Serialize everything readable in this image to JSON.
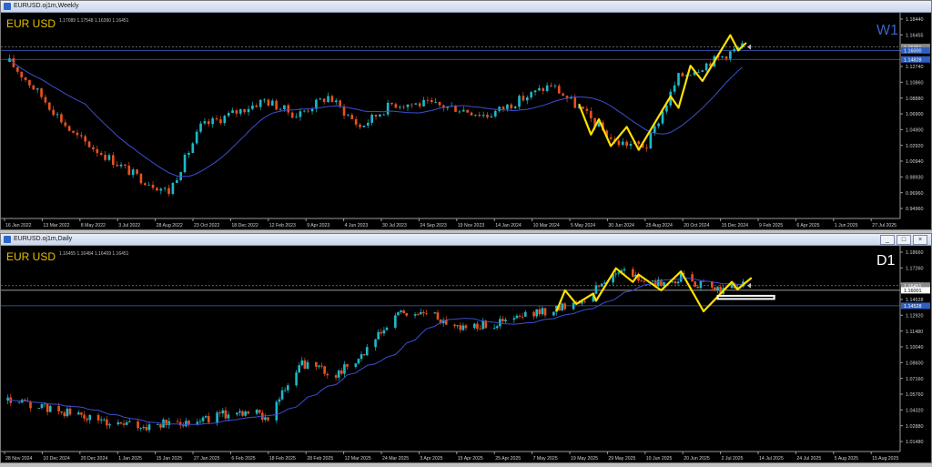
{
  "windows": [
    {
      "id": "weekly",
      "title": "EURUSD.oj1m,Weekly",
      "ohlc": "1.17089 1.17548 1.16390 1.16451",
      "symbol_label": "EUR USD",
      "timeframe_label": "W1",
      "price_ticks": [
        "1.18440",
        "1.16455",
        "1.14828",
        "1.12740",
        "1.10860",
        "1.08880",
        "1.06900",
        "1.04900",
        "1.02920",
        "1.00940",
        "0.98930",
        "0.96960",
        "0.94960"
      ],
      "price_badges": [
        {
          "value": "1.16451",
          "color": "#8a8a8a"
        },
        {
          "value": "1.16000",
          "color": "#2f5fbf"
        },
        {
          "value": "1.14828",
          "color": "#2f5fbf"
        }
      ],
      "date_ticks": [
        "16 Jan 2022",
        "13 Mar 2022",
        "8 May 2022",
        "3 Jul 2022",
        "28 Aug 2022",
        "23 Oct 2022",
        "18 Dec 2022",
        "12 Feb 2023",
        "9 Apr 2023",
        "4 Jun 2023",
        "30 Jul 2023",
        "24 Sep 2023",
        "19 Nov 2023",
        "14 Jan 2024",
        "10 Mar 2024",
        "5 May 2024",
        "30 Jun 2024",
        "25 Aug 2024",
        "20 Oct 2024",
        "15 Dec 2024",
        "9 Feb 2025",
        "6 Apr 2025",
        "1 Jun 2025",
        "27 Jul 2025"
      ]
    },
    {
      "id": "daily",
      "title": "EURUSD.oj1m,Daily",
      "ohlc": "1.16455 1.16484 1.16409 1.16451",
      "symbol_label": "EUR USD",
      "timeframe_label": "D1",
      "price_ticks": [
        "1.18660",
        "1.17260",
        "1.16001",
        "1.14528",
        "1.12920",
        "1.11480",
        "1.10040",
        "1.08600",
        "1.07160",
        "1.05760",
        "1.04320",
        "1.02880",
        "1.01480"
      ],
      "price_badges": [
        {
          "value": "1.16451",
          "color": "#8a8a8a"
        },
        {
          "value": "1.16001",
          "color": "#ffffff"
        },
        {
          "value": "1.14528",
          "color": "#2f5fbf"
        }
      ],
      "date_ticks": [
        "28 Nov 2024",
        "10 Dec 2024",
        "20 Dec 2024",
        "1 Jan 2025",
        "15 Jan 2025",
        "27 Jan 2025",
        "6 Feb 2025",
        "18 Feb 2025",
        "28 Feb 2025",
        "12 Mar 2025",
        "24 Mar 2025",
        "3 Apr 2025",
        "15 Apr 2025",
        "25 Apr 2025",
        "7 May 2025",
        "19 May 2025",
        "29 May 2025",
        "10 Jun 2025",
        "20 Jun 2025",
        "2 Jul 2025",
        "14 Jul 2025",
        "24 Jul 2025",
        "5 Aug 2025",
        "15 Aug 2025"
      ]
    }
  ],
  "window_buttons": {
    "minimize": "_",
    "maximize": "□",
    "close": "×"
  },
  "chart_data": [
    {
      "type": "candlestick",
      "title": "EURUSD.oj1m,Weekly",
      "series_name": "EUR USD",
      "timeframe": "W1",
      "ylim": [
        0.945,
        1.195
      ],
      "grid": false,
      "colors": {
        "bull": "#1fb8c8",
        "bear": "#e8501e",
        "ma": "#3c4fd0",
        "zigzag": "#ffe000"
      },
      "key_points": [
        {
          "date": "16 Jan 2022",
          "close": 1.145
        },
        {
          "date": "13 Mar 2022",
          "close": 1.1
        },
        {
          "date": "8 May 2022",
          "close": 1.05
        },
        {
          "date": "28 Aug 2022",
          "close": 0.995
        },
        {
          "date": "23 Oct 2022",
          "close": 0.975
        },
        {
          "date": "18 Dec 2022",
          "close": 1.06
        },
        {
          "date": "9 Apr 2023",
          "close": 1.095
        },
        {
          "date": "4 Jun 2023",
          "close": 1.075
        },
        {
          "date": "30 Jul 2023",
          "close": 1.1
        },
        {
          "date": "24 Sep 2023",
          "close": 1.06
        },
        {
          "date": "19 Nov 2023",
          "close": 1.09
        },
        {
          "date": "14 Jan 2024",
          "close": 1.09
        },
        {
          "date": "10 Mar 2024",
          "close": 1.085
        },
        {
          "date": "5 May 2024",
          "close": 1.075
        },
        {
          "date": "25 Aug 2024",
          "close": 1.115
        },
        {
          "date": "20 Oct 2024",
          "close": 1.08
        },
        {
          "date": "15 Dec 2024",
          "close": 1.04
        },
        {
          "date": "9 Feb 2025",
          "close": 1.035
        },
        {
          "date": "6 Apr 2025",
          "close": 1.125
        },
        {
          "date": "1 Jun 2025",
          "close": 1.145
        },
        {
          "date": "27 Jul 2025",
          "close": 1.165
        }
      ],
      "zigzag": [
        {
          "date": "13 Oct 2024",
          "price": 1.09
        },
        {
          "date": "3 Nov 2024",
          "price": 1.05
        },
        {
          "date": "17 Nov 2024",
          "price": 1.07
        },
        {
          "date": "8 Dec 2024",
          "price": 1.035
        },
        {
          "date": "5 Jan 2025",
          "price": 1.06
        },
        {
          "date": "26 Jan 2025",
          "price": 1.03
        },
        {
          "date": "23 Mar 2025",
          "price": 1.1
        },
        {
          "date": "6 Apr 2025",
          "price": 1.085
        },
        {
          "date": "27 Apr 2025",
          "price": 1.14
        },
        {
          "date": "18 May 2025",
          "price": 1.12
        },
        {
          "date": "6 Jul 2025",
          "price": 1.18
        },
        {
          "date": "20 Jul 2025",
          "price": 1.16
        },
        {
          "date": "3 Aug 2025",
          "price": 1.17
        }
      ],
      "horizontal_levels": [
        1.16451,
        1.16,
        1.14828
      ]
    },
    {
      "type": "candlestick",
      "title": "EURUSD.oj1m,Daily",
      "series_name": "EUR USD",
      "timeframe": "D1",
      "ylim": [
        1.01,
        1.192
      ],
      "grid": false,
      "colors": {
        "bull": "#1fb8c8",
        "bear": "#e8501e",
        "ma": "#3c4fd0",
        "zigzag": "#ffe000",
        "box": "#ffffff"
      },
      "key_points": [
        {
          "date": "28 Nov 2024",
          "close": 1.055
        },
        {
          "date": "20 Dec 2024",
          "close": 1.043
        },
        {
          "date": "1 Jan 2025",
          "close": 1.035
        },
        {
          "date": "15 Jan 2025",
          "close": 1.03
        },
        {
          "date": "6 Feb 2025",
          "close": 1.038
        },
        {
          "date": "18 Feb 2025",
          "close": 1.045
        },
        {
          "date": "28 Feb 2025",
          "close": 1.04
        },
        {
          "date": "12 Mar 2025",
          "close": 1.09
        },
        {
          "date": "24 Mar 2025",
          "close": 1.08
        },
        {
          "date": "3 Apr 2025",
          "close": 1.1
        },
        {
          "date": "15 Apr 2025",
          "close": 1.138
        },
        {
          "date": "25 Apr 2025",
          "close": 1.138
        },
        {
          "date": "7 May 2025",
          "close": 1.125
        },
        {
          "date": "19 May 2025",
          "close": 1.128
        },
        {
          "date": "29 May 2025",
          "close": 1.135
        },
        {
          "date": "10 Jun 2025",
          "close": 1.143
        },
        {
          "date": "20 Jun 2025",
          "close": 1.152
        },
        {
          "date": "2 Jul 2025",
          "close": 1.18
        },
        {
          "date": "14 Jul 2025",
          "close": 1.165
        },
        {
          "date": "24 Jul 2025",
          "close": 1.172
        },
        {
          "date": "5 Aug 2025",
          "close": 1.16
        },
        {
          "date": "15 Aug 2025",
          "close": 1.165
        }
      ],
      "zigzag": [
        {
          "date": "10 Jun 2025",
          "price": 1.14
        },
        {
          "date": "13 Jun 2025",
          "price": 1.16
        },
        {
          "date": "17 Jun 2025",
          "price": 1.147
        },
        {
          "date": "23 Jun 2025",
          "price": 1.157
        },
        {
          "date": "24 Jun 2025",
          "price": 1.15
        },
        {
          "date": "1 Jul 2025",
          "price": 1.181
        },
        {
          "date": "7 Jul 2025",
          "price": 1.168
        },
        {
          "date": "9 Jul 2025",
          "price": 1.175
        },
        {
          "date": "17 Jul 2025",
          "price": 1.16
        },
        {
          "date": "24 Jul 2025",
          "price": 1.178
        },
        {
          "date": "1 Aug 2025",
          "price": 1.14
        },
        {
          "date": "11 Aug 2025",
          "price": 1.168
        },
        {
          "date": "13 Aug 2025",
          "price": 1.161
        },
        {
          "date": "18 Aug 2025",
          "price": 1.172
        }
      ],
      "box": {
        "price_top": 1.1548,
        "price_bottom": 1.1518,
        "date_start": "6 Aug 2025",
        "date_end": "26 Aug 2025"
      },
      "horizontal_levels": [
        1.16451,
        1.16001,
        1.14528
      ]
    }
  ]
}
